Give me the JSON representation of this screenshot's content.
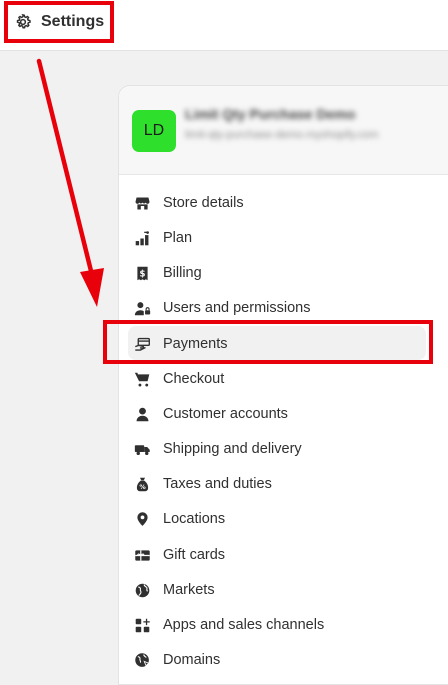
{
  "topbar": {
    "settings_label": "Settings"
  },
  "store": {
    "initials": "LD",
    "name": "Limit Qty Purchase Demo",
    "url": "limit-qty-purchase-demo.myshopify.com",
    "avatar_color": "#2ee02b"
  },
  "nav": {
    "items": [
      {
        "label": "Store details",
        "icon": "store-icon"
      },
      {
        "label": "Plan",
        "icon": "plan-icon"
      },
      {
        "label": "Billing",
        "icon": "receipt-dollar-icon"
      },
      {
        "label": "Users and permissions",
        "icon": "person-lock-icon"
      },
      {
        "label": "Payments",
        "icon": "payment-hand-icon"
      },
      {
        "label": "Checkout",
        "icon": "cart-icon"
      },
      {
        "label": "Customer accounts",
        "icon": "person-icon"
      },
      {
        "label": "Shipping and delivery",
        "icon": "truck-icon"
      },
      {
        "label": "Taxes and duties",
        "icon": "tax-bag-icon"
      },
      {
        "label": "Locations",
        "icon": "location-pin-icon"
      },
      {
        "label": "Gift cards",
        "icon": "gift-card-icon"
      },
      {
        "label": "Markets",
        "icon": "globe-icon"
      },
      {
        "label": "Apps and sales channels",
        "icon": "apps-icon"
      },
      {
        "label": "Domains",
        "icon": "domain-globe-icon"
      }
    ],
    "active": "Payments"
  },
  "annotation": {
    "color": "#e8000b"
  }
}
